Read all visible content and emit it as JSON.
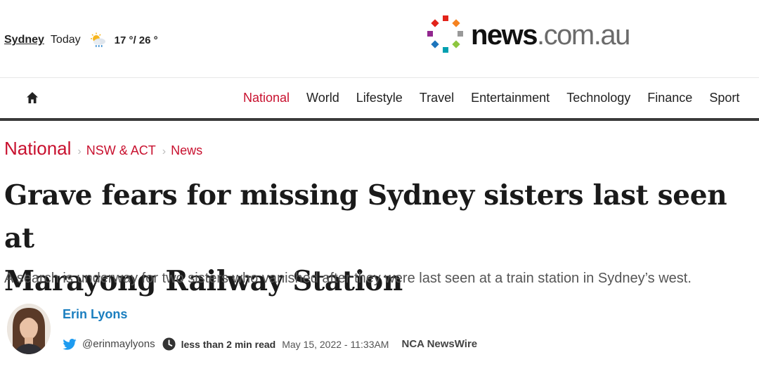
{
  "weather": {
    "city": "Sydney",
    "day": "Today",
    "icon": "partly-cloudy-rain-icon",
    "temp": "17 °/ 26 °"
  },
  "logo": {
    "brand_bold": "news",
    "brand_light": ".com.au",
    "colors": [
      "#e2231a",
      "#f58220",
      "#8dc63f",
      "#00a0b0",
      "#1d75bc",
      "#92278f",
      "#999999"
    ]
  },
  "nav": {
    "home_icon": "home-icon",
    "items": [
      "National",
      "World",
      "Lifestyle",
      "Travel",
      "Entertainment",
      "Technology",
      "Finance",
      "Sport"
    ],
    "active": "National"
  },
  "breadcrumb": {
    "section": "National",
    "sub1": "NSW & ACT",
    "sub2": "News"
  },
  "article": {
    "headline_line1": "Grave fears for missing Sydney sisters last seen at",
    "headline_line2": "Marayong Railway Station",
    "standfirst": "A search is underway for two sisters who vanished after they were last seen at a train station in Sydney’s west."
  },
  "byline": {
    "author": "Erin Lyons",
    "twitter_handle": "@erinmaylyons",
    "read_time": "less than 2 min read",
    "date": "May 15, 2022 - 11:33AM",
    "source": "NCA NewsWire"
  },
  "colors": {
    "accent_red": "#c8102e",
    "author_blue": "#1a7ebf",
    "nav_rule": "#3a3a3a"
  }
}
